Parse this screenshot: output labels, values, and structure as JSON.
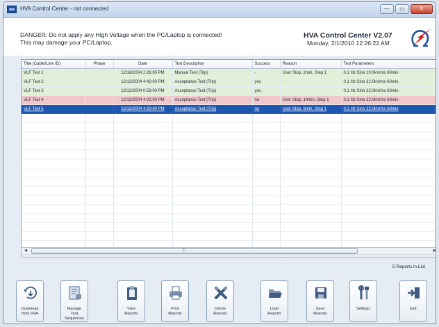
{
  "window": {
    "title": "HVA Control Center - not connected",
    "buttons": {
      "minimize": "—",
      "maximize": "▭",
      "close": "✕"
    }
  },
  "header": {
    "danger_line1": "DANGER: Do not apply any High Voltage when the PC/Laptop is connected!",
    "danger_line2": "This may damage your PC/Laptop.",
    "app_title": "HVA Control Center V2.07",
    "app_date": "Monday, 2/1/2010 12:26:22 AM",
    "logo_icon": "omega-lightning-icon"
  },
  "table": {
    "columns": [
      "Title (Cable/Line ID)",
      "Phase",
      "Date",
      "Test Description",
      "Success",
      "Reason",
      "Test Parameters"
    ],
    "rows": [
      {
        "title": "VLF Test 1",
        "phase": "",
        "date": "12/18/2004 2:26:00 PM",
        "description": "Manual Test (Trip)",
        "success": "-",
        "reason": "User Stop, 2min, Step 1",
        "params": "0.1 Hz Sine 19.0kVrms 60min",
        "status": "green"
      },
      {
        "title": "VLF Test 2",
        "phase": "",
        "date": "12/13/2004 4:42:00 PM",
        "description": "Acceptance Test (Trip)",
        "success": "yes",
        "reason": "-",
        "params": "0.1 Hz Sine 22.0kVrms 60min",
        "status": "green"
      },
      {
        "title": "VLF Test 3",
        "phase": "",
        "date": "12/13/2004 0:59:00 PM",
        "description": "Acceptance Test (Trip)",
        "success": "yes",
        "reason": "",
        "params": "0.1 Hz Sine 22.0kVrms 60min",
        "status": "green"
      },
      {
        "title": "VLF Test 4",
        "phase": "",
        "date": "12/13/2004 4:02:00 PM",
        "description": "Acceptance Test (Trip)",
        "success": "no",
        "reason": "User Stop, 14min, Step 1",
        "params": "0.1 Hz Sine 22.0kVrms 60min",
        "status": "red"
      },
      {
        "title": "VLF Test 5",
        "phase": "",
        "date": "12/13/2004 4:20:00 PM",
        "description": "Acceptance Test (Trip)",
        "success": "no",
        "reason": "User Stop, 6min, Step 1",
        "params": "0.1 Hz Sine 22.0kVrms 60min",
        "status": "selected"
      }
    ],
    "empty_rows": 16
  },
  "scrollbar": {
    "left_arrow": "◄",
    "right_arrow": "►",
    "grip": "|||"
  },
  "status": {
    "report_count": "5 Reports in List"
  },
  "toolbar": {
    "buttons": [
      {
        "id": "download",
        "line1": "Download",
        "line2": "from HVA",
        "icon": "download-arrow-icon"
      },
      {
        "id": "manage",
        "line1": "Manage",
        "line2": "Test Sequences",
        "icon": "sequence-puzzle-icon"
      },
      {
        "id": "view",
        "line1": "View",
        "line2": "Reports",
        "icon": "clipboard-icon"
      },
      {
        "id": "print",
        "line1": "Print",
        "line2": "Reports",
        "icon": "printer-icon"
      },
      {
        "id": "delete",
        "line1": "Delete",
        "line2": "Reports",
        "icon": "delete-x-icon"
      },
      {
        "id": "load",
        "line1": "Load",
        "line2": "Reports",
        "icon": "open-folder-icon"
      },
      {
        "id": "save",
        "line1": "Save",
        "line2": "Reports",
        "icon": "save-disk-icon"
      },
      {
        "id": "settings",
        "line1": "Settings",
        "line2": "",
        "icon": "tools-icon"
      },
      {
        "id": "exit",
        "line1": "Exit",
        "line2": "",
        "icon": "exit-door-icon"
      }
    ]
  },
  "colors": {
    "row_green": "#e2f0d9",
    "row_red": "#f2c7cb",
    "row_selected": "#1e57b0",
    "logo_red": "#d8231c",
    "logo_blue": "#1f4f9a"
  }
}
